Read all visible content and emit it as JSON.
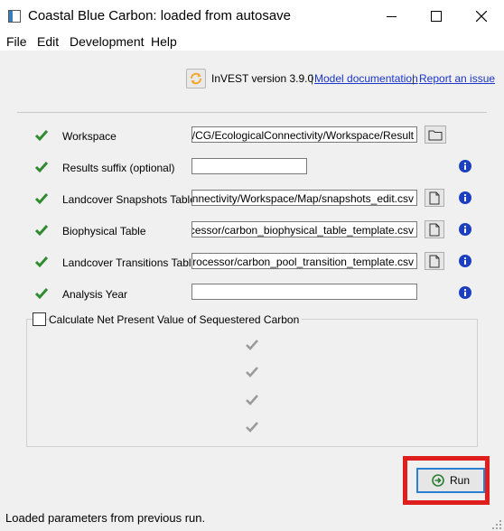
{
  "window": {
    "title": "Coastal Blue Carbon: loaded from autosave",
    "app_icon": "app-window-icon",
    "controls": [
      "minimize-icon",
      "maximize-icon",
      "close-icon"
    ]
  },
  "menu": {
    "items": [
      {
        "label": "File"
      },
      {
        "label": "Edit"
      },
      {
        "label": "Development"
      },
      {
        "label": "Help"
      }
    ]
  },
  "header": {
    "version_text": "InVEST version 3.9.0",
    "separator": "|",
    "doc_link": "Model documentation",
    "issue_link": "Report an issue"
  },
  "fields": [
    {
      "label": "Workspace",
      "value": "y tính/CG/EcologicalConnectivity/Workspace/Result",
      "button": "folder-icon",
      "info": false
    },
    {
      "label": "Results suffix (optional)",
      "value": "",
      "button": null,
      "info": true
    },
    {
      "label": "Landcover Snapshots Table",
      "value": "calConnectivity/Workspace/Map/snapshots_edit.csv",
      "button": "file-icon",
      "info": true
    },
    {
      "label": "Biophysical Table",
      "value": "eprocessor/carbon_biophysical_table_template.csv",
      "button": "file-icon",
      "info": true
    },
    {
      "label": "Landcover Transitions Table",
      "value": "preprocessor/carbon_pool_transition_template.csv",
      "button": "file-icon",
      "info": true
    },
    {
      "label": "Analysis Year",
      "value": "",
      "button": null,
      "info": true
    }
  ],
  "npv": {
    "label": "Calculate Net Present Value of Sequestered Carbon",
    "checked": false
  },
  "run_button": {
    "label": "Run",
    "icon": "run-arrow-icon"
  },
  "status": {
    "text": "Loaded parameters from previous run."
  },
  "colors": {
    "check_green": "#2e8b2e",
    "info_blue": "#1b3fbf",
    "link_blue": "#1a35c9",
    "highlight_red": "#e01e1e",
    "run_focus_blue": "#2d7fd1"
  }
}
